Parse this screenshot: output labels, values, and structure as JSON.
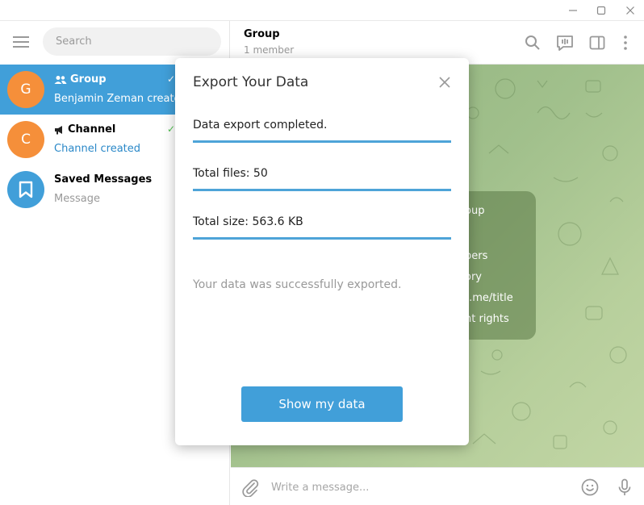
{
  "sidebar": {
    "search_placeholder": "Search",
    "chats": [
      {
        "avatar_letter": "G",
        "avatar_color": "#f58f3a",
        "title": "Group",
        "subtitle": "Benjamin Zeman created",
        "type_icon": "group-icon",
        "status": "✓"
      },
      {
        "avatar_letter": "C",
        "avatar_color": "#f58f3a",
        "title": "Channel",
        "subtitle": "Channel created",
        "type_icon": "megaphone-icon",
        "status": "✓"
      },
      {
        "avatar_letter": "",
        "avatar_color": "#419fd9",
        "title": "Saved Messages",
        "subtitle": "Message",
        "type_icon": "bookmark-icon",
        "status": ""
      }
    ]
  },
  "header": {
    "title": "Group",
    "subtitle": "1 member"
  },
  "info_card": {
    "lines": [
      "oup",
      "bers",
      "ory",
      "t.me/title",
      "nt rights"
    ]
  },
  "composer": {
    "placeholder": "Write a message..."
  },
  "modal": {
    "title": "Export Your Data",
    "status": "Data export completed.",
    "total_files": "Total files: 50",
    "total_size": "Total size: 563.6 KB",
    "note": "Your data was successfully exported.",
    "button_label": "Show my data"
  },
  "colors": {
    "accent": "#419fd9",
    "underline": "#4ea4d8",
    "avatar_orange": "#f58f3a",
    "check_green": "#4dbf4d"
  }
}
